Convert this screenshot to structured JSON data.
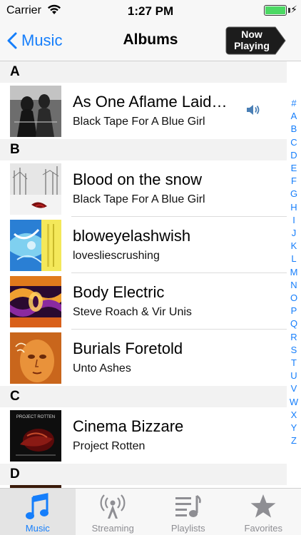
{
  "status_bar": {
    "carrier": "Carrier",
    "time": "1:27 PM",
    "battery_level": 1.0,
    "charging": true
  },
  "nav": {
    "back_label": "Music",
    "title": "Albums",
    "now_playing_line1": "Now",
    "now_playing_line2": "Playing"
  },
  "sections": [
    {
      "letter": "A",
      "albums": [
        {
          "title": "As One Aflame Laid…",
          "artist": "Black Tape For A Blue Girl",
          "playing": true,
          "art": "black-and-white-figures"
        }
      ]
    },
    {
      "letter": "B",
      "albums": [
        {
          "title": "Blood on the snow",
          "artist": "Black Tape For A Blue Girl",
          "playing": false,
          "art": "snowy-trees"
        },
        {
          "title": "bloweyelashwish",
          "artist": "lovesliescrushing",
          "playing": false,
          "art": "blue-yellow-abstract"
        },
        {
          "title": "Body Electric",
          "artist": "Steve Roach & Vir Unis",
          "playing": false,
          "art": "orange-purple-fractal"
        },
        {
          "title": "Burials Foretold",
          "artist": "Unto Ashes",
          "playing": false,
          "art": "orange-face"
        }
      ]
    },
    {
      "letter": "C",
      "albums": [
        {
          "title": "Cinema Bizzare",
          "artist": "Project Rotten",
          "playing": false,
          "art": "dark-red-abstract",
          "art_text": "PROJECT ROTTEN"
        }
      ]
    },
    {
      "letter": "D",
      "albums": []
    }
  ],
  "index": [
    "#",
    "A",
    "B",
    "C",
    "D",
    "E",
    "F",
    "G",
    "H",
    "I",
    "J",
    "K",
    "L",
    "M",
    "N",
    "O",
    "P",
    "Q",
    "R",
    "S",
    "T",
    "U",
    "V",
    "W",
    "X",
    "Y",
    "Z"
  ],
  "tabs": [
    {
      "label": "Music",
      "icon": "music-note-icon",
      "active": true
    },
    {
      "label": "Streaming",
      "icon": "broadcast-icon",
      "active": false
    },
    {
      "label": "Playlists",
      "icon": "playlist-icon",
      "active": false
    },
    {
      "label": "Favorites",
      "icon": "star-icon",
      "active": false
    }
  ],
  "colors": {
    "accent": "#157efb",
    "now_playing_bg": "#1c1c1c"
  }
}
